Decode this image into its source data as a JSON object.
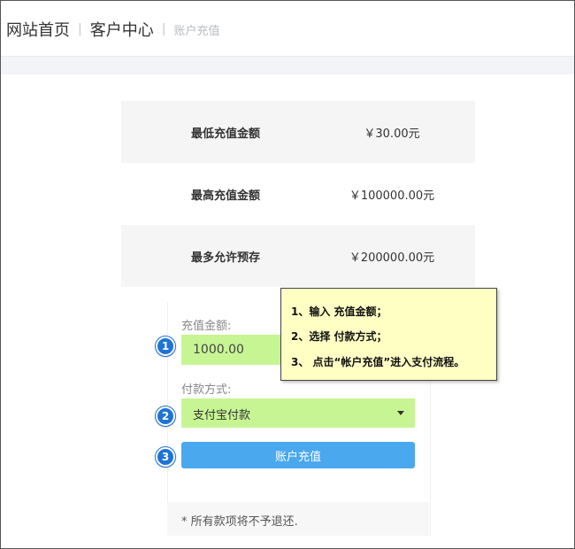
{
  "breadcrumb": {
    "home": "网站首页",
    "customer_center": "客户中心",
    "current": "账户充值",
    "separator": "|"
  },
  "limits": [
    {
      "label": "最低充值金额",
      "value": "￥30.00元"
    },
    {
      "label": "最高充值金额",
      "value": "￥100000.00元"
    },
    {
      "label": "最多允许预存",
      "value": "￥200000.00元"
    }
  ],
  "form": {
    "amount_label": "充值金额:",
    "amount_value": "1000.00",
    "payment_label": "付款方式:",
    "payment_selected": "支付宝付款",
    "submit_label": "账户充值",
    "note": "* 所有款项将不予退还."
  },
  "steps": {
    "badges": [
      "1",
      "2",
      "3"
    ],
    "instructions": [
      "1、输入 充值金额；",
      "2、选择 付款方式；",
      "3、 点击“帐户充值”进入支付流程。"
    ]
  },
  "colors": {
    "highlight_green": "#c7f594",
    "button_blue": "#4aa8ef",
    "badge_blue": "#1f73d6",
    "callout_yellow": "#ffffc4"
  }
}
